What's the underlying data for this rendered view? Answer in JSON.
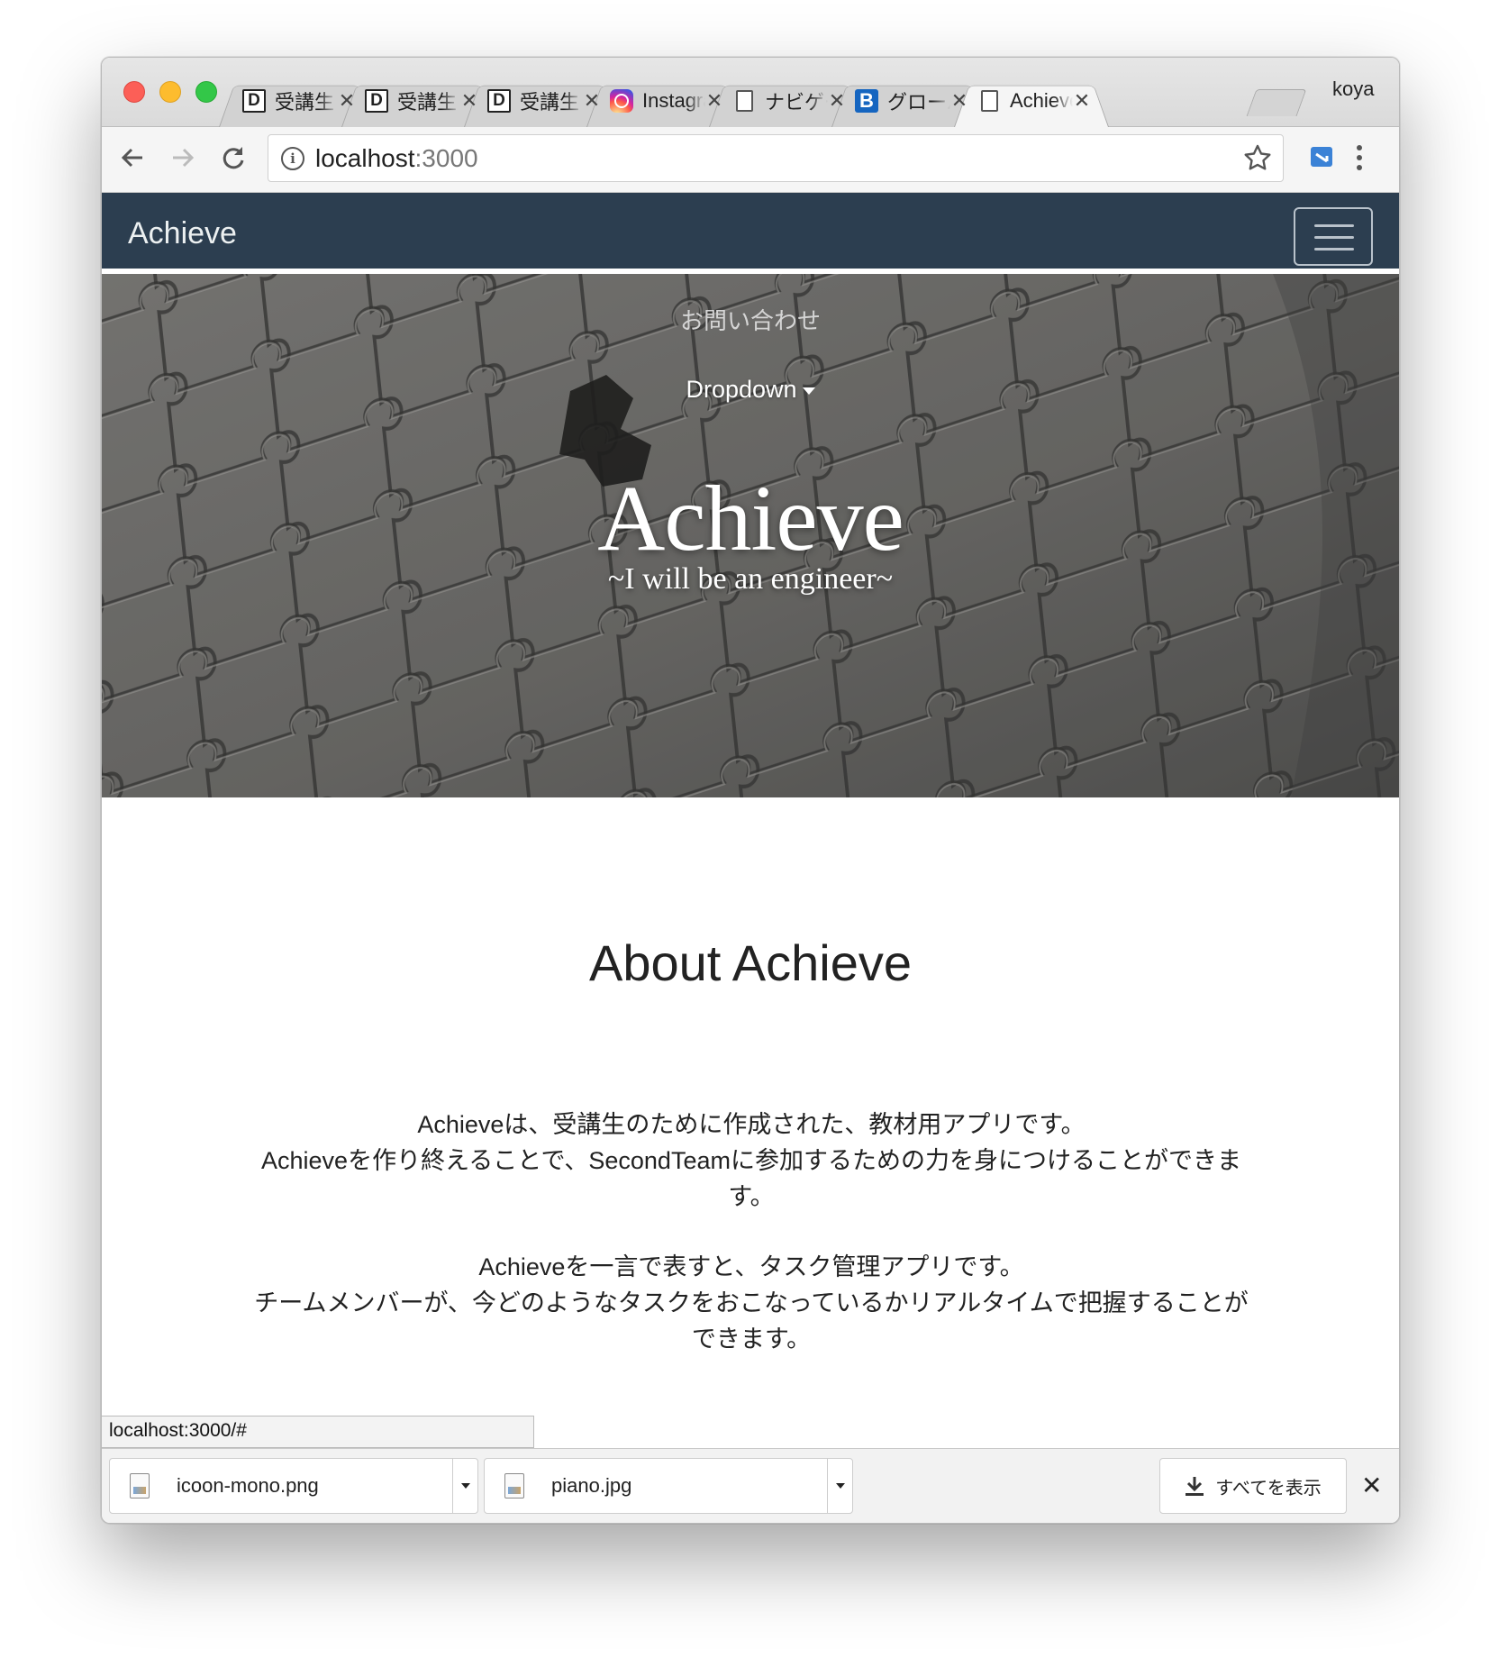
{
  "browser": {
    "tabs": [
      {
        "favicon": "d-icon",
        "title": "受講生"
      },
      {
        "favicon": "d-icon",
        "title": "受講生"
      },
      {
        "favicon": "d-icon",
        "title": "受講生"
      },
      {
        "favicon": "instagram-icon",
        "title": "Instagram"
      },
      {
        "favicon": "page-icon",
        "title": "ナビゲーション"
      },
      {
        "favicon": "b-icon",
        "title": "グローバル"
      },
      {
        "favicon": "page-icon",
        "title": "Achieve",
        "active": true
      }
    ],
    "close_glyph": "✕",
    "profile_name": "koya",
    "url_host": "localhost",
    "url_port": ":3000",
    "status_url": "localhost:3000/#"
  },
  "site": {
    "brand": "Achieve",
    "nav_contact": "お問い合わせ",
    "nav_dropdown": "Dropdown",
    "hero_title": "Achieve",
    "hero_subtitle": "~I will be an engineer~",
    "about_title": "About Achieve",
    "about_p1_line1": "Achieveは、受講生のために作成された、教材用アプリです。",
    "about_p1_line2": "Achieveを作り終えることで、SecondTeamに参加するための力を身につけることができます。",
    "about_p2_line1": "Achieveを一言で表すと、タスク管理アプリです。",
    "about_p2_line2": "チームメンバーが、今どのようなタスクをおこなっているかリアルタイムで把握することができます。"
  },
  "downloads": {
    "items": [
      {
        "name": "icoon-mono.png"
      },
      {
        "name": "piano.jpg"
      }
    ],
    "show_all_label": "すべてを表示",
    "close_glyph": "✕"
  },
  "colors": {
    "navbar_bg": "#2c3e50",
    "brand_text": "#ecf0f1"
  }
}
